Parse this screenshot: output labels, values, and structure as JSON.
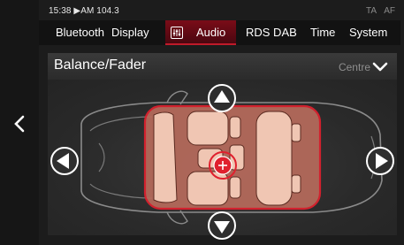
{
  "status": {
    "time": "15:38",
    "source": "AM 104.3",
    "indicators": [
      "TA",
      "AF"
    ]
  },
  "tabs": [
    {
      "label": "Bluetooth",
      "active": false
    },
    {
      "label": "Display",
      "active": false
    },
    {
      "label": "Audio",
      "active": true,
      "icon": "equalizer-icon"
    },
    {
      "label": "RDS DAB",
      "active": false
    },
    {
      "label": "Time",
      "active": false
    },
    {
      "label": "System",
      "active": false
    }
  ],
  "panel": {
    "title": "Balance/Fader",
    "position_label": "Centre"
  },
  "balance_fader": {
    "balance": 0,
    "fader": 0
  },
  "colors": {
    "accent": "#c01a2a",
    "highlight": "#e0202e",
    "cabin_fill": "#b76b5c",
    "seat": "#f0c6b3"
  }
}
